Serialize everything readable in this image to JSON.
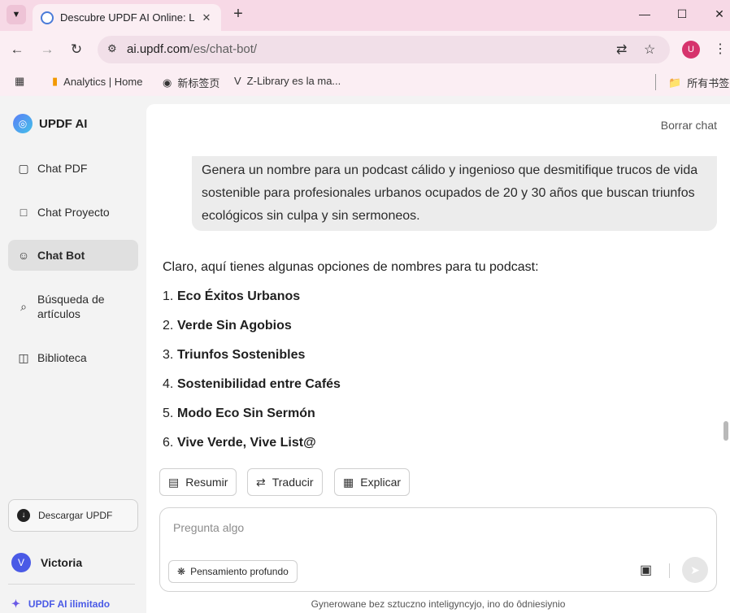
{
  "browser": {
    "tab_title": "Descubre UPDF AI Online: La",
    "url_host": "ai.updf.com",
    "url_path": "/es/chat-bot/",
    "profile_initial": "U",
    "bookmarks": [
      {
        "label": "Analytics | Home",
        "icon": "analytics-icon"
      },
      {
        "label": "新标签页",
        "icon": "globe-icon"
      },
      {
        "label": "Z-Library es la ma...",
        "icon": "zlibrary-icon"
      }
    ],
    "all_bookmarks_label": "所有书签"
  },
  "sidebar": {
    "brand": "UPDF AI",
    "items": [
      {
        "label": "Chat PDF",
        "icon": "chat-pdf-icon"
      },
      {
        "label": "Chat Proyecto",
        "icon": "folder-icon"
      },
      {
        "label": "Chat Bot",
        "icon": "bot-icon",
        "active": true
      },
      {
        "label": "Búsqueda de artículos",
        "icon": "search-doc-icon"
      },
      {
        "label": "Biblioteca",
        "icon": "library-icon"
      }
    ],
    "download_label": "Descargar UPDF",
    "user_initial": "V",
    "user_name": "Victoria",
    "upgrade_label": "UPDF AI ilimitado"
  },
  "chat": {
    "clear_label": "Borrar chat",
    "user_message": "Genera un nombre para un podcast cálido y ingenioso que desmitifique trucos de vida sostenible para profesionales urbanos ocupados de 20 y 30 años que buscan triunfos ecológicos sin culpa y sin sermoneos.",
    "answer_intro": "Claro, aquí tienes algunas opciones de nombres para tu podcast:",
    "answer_items": [
      {
        "num": "1.",
        "text": "Eco Éxitos Urbanos"
      },
      {
        "num": "2.",
        "text": "Verde Sin Agobios"
      },
      {
        "num": "3.",
        "text": "Triunfos Sostenibles"
      },
      {
        "num": "4.",
        "text": "Sostenibilidad entre Cafés"
      },
      {
        "num": "5.",
        "text": "Modo Eco Sin Sermón"
      },
      {
        "num": "6.",
        "text": "Vive Verde, Vive List@"
      }
    ],
    "actions": {
      "summarize": "Resumir",
      "translate": "Traducir",
      "explain": "Explicar"
    },
    "composer": {
      "placeholder": "Pregunta algo",
      "deep_think_label": "Pensamiento profundo"
    },
    "disclaimer": "Gynerowane bez sztuczno inteligyncyjo, ino do ôdniesiynio"
  }
}
